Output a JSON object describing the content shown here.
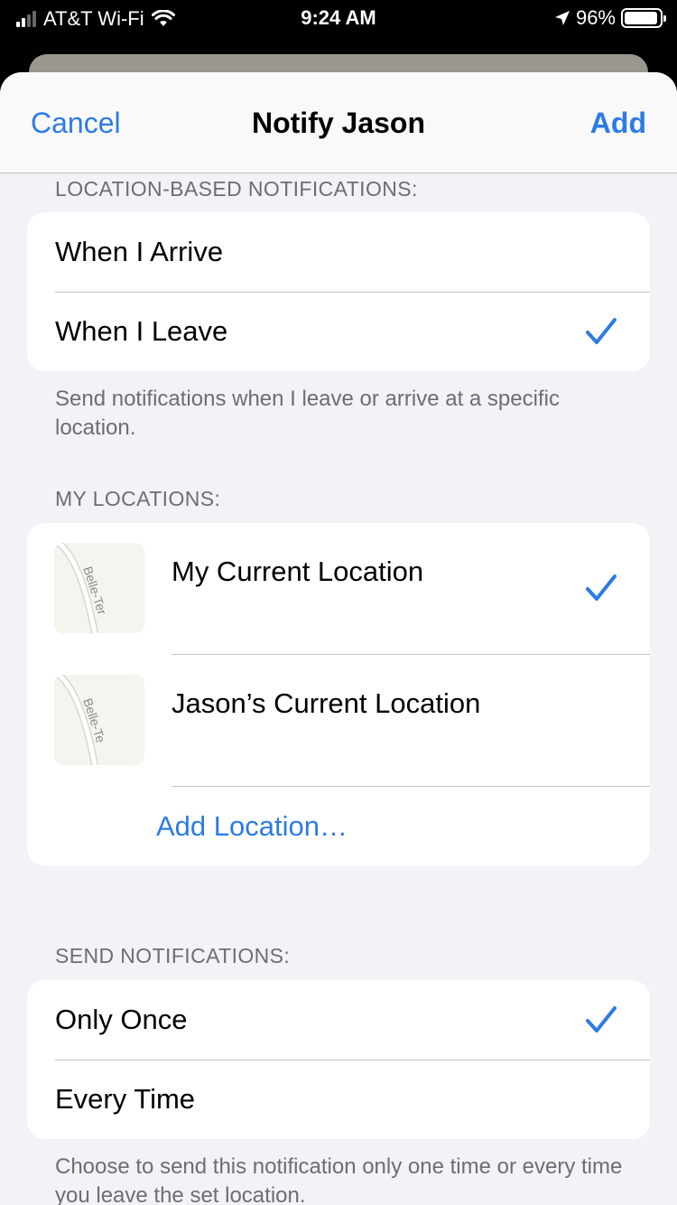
{
  "status_bar": {
    "carrier": "AT&T Wi-Fi",
    "time": "9:24 AM",
    "battery": "96%",
    "battery_level": 0.96
  },
  "nav": {
    "cancel_label": "Cancel",
    "title": "Notify Jason",
    "add_label": "Add"
  },
  "location_notifications": {
    "header": "LOCATION-BASED NOTIFICATIONS:",
    "options": [
      {
        "label": "When I Arrive",
        "selected": false
      },
      {
        "label": "When I Leave",
        "selected": true
      }
    ],
    "footer": "Send notifications when I leave or arrive at a specific location."
  },
  "my_locations": {
    "header": "MY LOCATIONS:",
    "items": [
      {
        "label": "My Current Location",
        "map_label": "Belle-Ter",
        "selected": true
      },
      {
        "label": "Jason’s Current Location",
        "map_label": "Belle-Te",
        "selected": false
      }
    ],
    "add_label": "Add Location…"
  },
  "send_notifications": {
    "header": "SEND NOTIFICATIONS:",
    "options": [
      {
        "label": "Only Once",
        "selected": true
      },
      {
        "label": "Every Time",
        "selected": false
      }
    ],
    "footer": "Choose to send this notification only one time or every time you leave the set location."
  },
  "colors": {
    "accent": "#2c7be5",
    "background": "#f2f2f7",
    "secondary_text": "#6d6d72"
  }
}
